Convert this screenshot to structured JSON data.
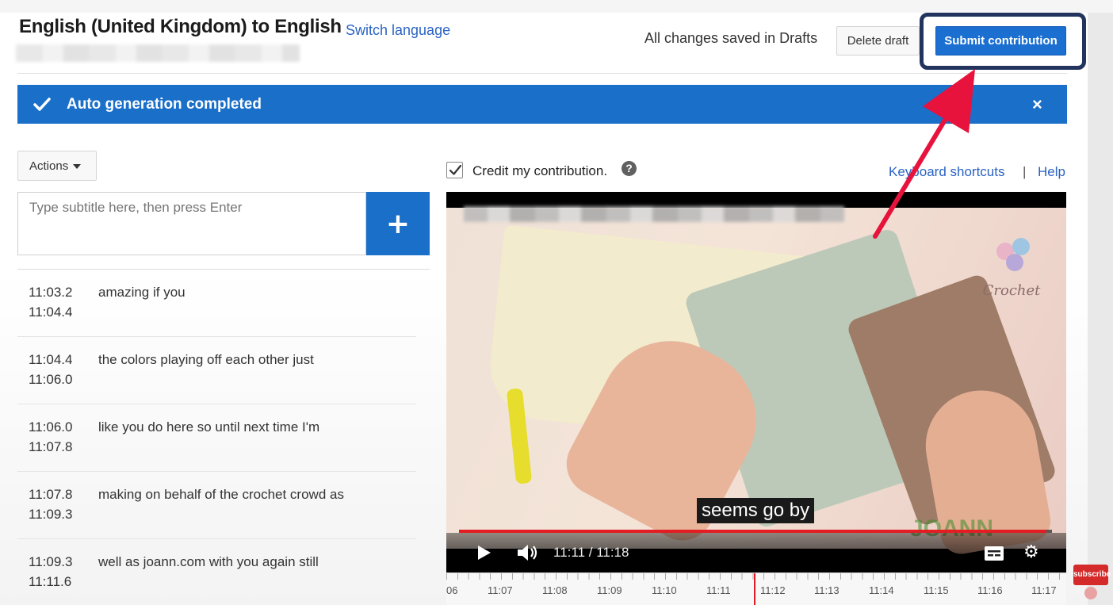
{
  "header": {
    "title": "English (United Kingdom) to English",
    "switch_language": "Switch language",
    "saved_status": "All changes saved in Drafts",
    "delete_draft": "Delete draft",
    "submit_contribution": "Submit contribution"
  },
  "banner": {
    "message": "Auto generation completed",
    "close": "×",
    "color": "#1a6fc9"
  },
  "editor": {
    "actions_label": "Actions",
    "input_placeholder": "Type subtitle here, then press Enter",
    "add_label": "+"
  },
  "subtitles": [
    {
      "start": "11:03.2",
      "end": "11:04.4",
      "text": "amazing if you"
    },
    {
      "start": "11:04.4",
      "end": "11:06.0",
      "text": "the colors playing off each other just"
    },
    {
      "start": "11:06.0",
      "end": "11:07.8",
      "text": "like you do here so until next time I'm"
    },
    {
      "start": "11:07.8",
      "end": "11:09.3",
      "text": "making on behalf of the crochet crowd as"
    },
    {
      "start": "11:09.3",
      "end": "11:11.6",
      "text": "well as joann.com with you again still"
    }
  ],
  "options": {
    "credit_label": "Credit my contribution.",
    "credit_checked": true,
    "help_icon": "?",
    "keyboard_shortcuts": "Keyboard shortcuts",
    "separator": "|",
    "help": "Help"
  },
  "video": {
    "caption": "seems go by",
    "time": "11:11 / 11:18",
    "progress_fraction": 0.99,
    "watermark": "Crochet",
    "watermark_brand": "JOANN"
  },
  "timeline": {
    "labels": [
      "06",
      "11:07",
      "11:08",
      "11:09",
      "11:10",
      "11:11",
      "11:12",
      "11:13",
      "11:14",
      "11:15",
      "11:16",
      "11:17"
    ]
  },
  "overlay": {
    "subscribe": "subscribe",
    "accent_color": "#e8133c"
  }
}
